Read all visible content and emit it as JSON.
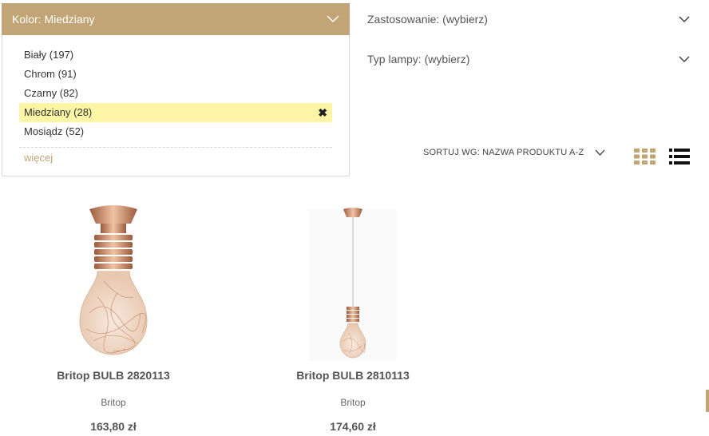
{
  "filters": {
    "color": {
      "label": "Kolor: Miedziany",
      "options": [
        {
          "label": "Biały (197)",
          "selected": false
        },
        {
          "label": "Chrom (91)",
          "selected": false
        },
        {
          "label": "Czarny (82)",
          "selected": false
        },
        {
          "label": "Miedziany (28)",
          "selected": true
        },
        {
          "label": "Mosiądz (52)",
          "selected": false
        }
      ],
      "remove_icon": "✖",
      "more_label": "więcej"
    },
    "usage": {
      "label": "Zastosowanie: (wybierz)"
    },
    "lamp_type": {
      "label": "Typ lampy: (wybierz)"
    }
  },
  "sort": {
    "label": "SORTUJ WG: NAZWA PRODUKTU A-Z"
  },
  "view_icons": [
    "grid-view-icon",
    "list-view-icon"
  ],
  "products": [
    {
      "name": "Britop BULB 2820113",
      "brand": "Britop",
      "price": "163,80 zł",
      "image": "copper-bulb-ceiling-lamp"
    },
    {
      "name": "Britop BULB 2810113",
      "brand": "Britop",
      "price": "174,60 zł",
      "image": "copper-bulb-pendant-lamp"
    }
  ],
  "colors": {
    "accent": "#c2a576",
    "selected_bg": "#fbf5a5",
    "copper": "#c8825f"
  }
}
